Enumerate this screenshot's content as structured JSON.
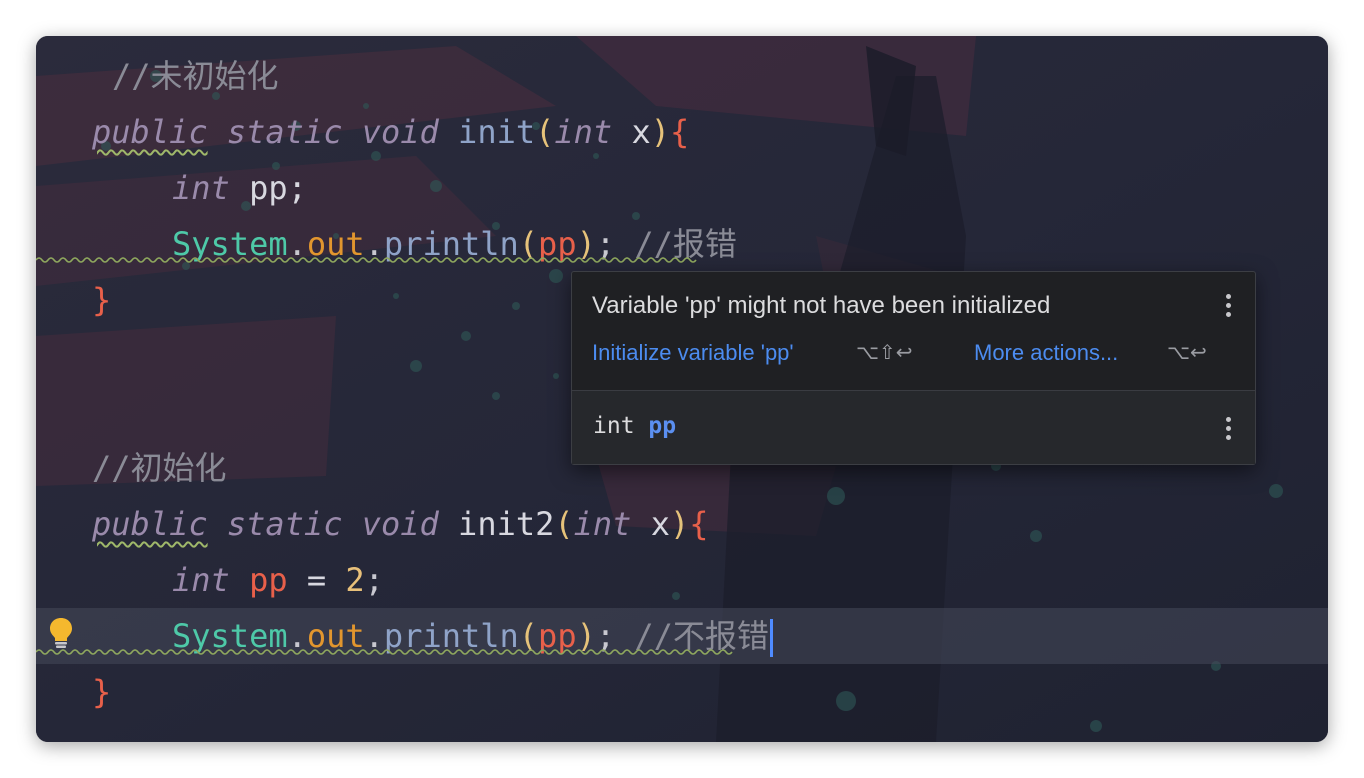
{
  "editor": {
    "lines": {
      "l1_comment": "//未初始化",
      "l2_public": "public",
      "l2_static": "static",
      "l2_void": "void",
      "l2_name": "init",
      "l2_int": "int",
      "l2_param": "x",
      "l3_int": "int",
      "l3_var": "pp;",
      "l4_class": "System",
      "l4_field": "out",
      "l4_method": "println",
      "l4_arg": "pp",
      "l4_comment": "//报错",
      "l5_brace": "}",
      "l6_comment": "//初始化",
      "l7_public": "public",
      "l7_static": "static",
      "l7_void": "void",
      "l7_name": "init2",
      "l7_int": "int",
      "l7_param": "x",
      "l8_int": "int",
      "l8_var": "pp",
      "l8_eq": "=",
      "l8_num": "2",
      "l9_class": "System",
      "l9_field": "out",
      "l9_method": "println",
      "l9_arg": "pp",
      "l9_comment": "//不报错",
      "l10_brace": "}"
    },
    "gutter_icon": "lightbulb-icon"
  },
  "popup": {
    "message": "Variable 'pp' might not have been initialized",
    "action_primary": "Initialize variable 'pp'",
    "action_primary_shortcut": "⌥⇧↩",
    "action_more": "More actions...",
    "action_more_shortcut": "⌥↩",
    "decl_type": "int",
    "decl_name": "pp",
    "menu_icon": "more-vertical-icon"
  },
  "colors": {
    "background": "#262838",
    "keyword": "#9a8aab",
    "class": "#4ec9a8",
    "field": "#e2962e",
    "brace": "#e8604a",
    "link": "#4c8cf0",
    "warning_underline": "#9fb86a"
  }
}
